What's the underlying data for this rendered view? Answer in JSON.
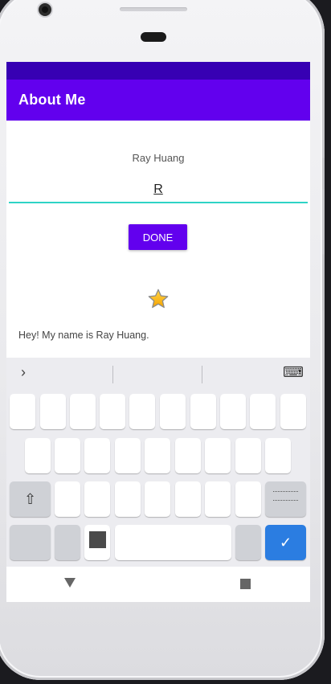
{
  "app": {
    "title": "About Me",
    "colors": {
      "status_bar": "#3700b3",
      "app_bar": "#6200ee",
      "input_underline": "#2ed3c6",
      "done_button": "#6200ee"
    }
  },
  "profile": {
    "name": "Ray Huang",
    "nickname_value": "R",
    "done_label": "DONE",
    "star_icon": "star-icon",
    "bio": "Hey! My name is Ray Huang."
  },
  "keyboard": {
    "expand_icon": "chevron-right-icon",
    "keyboard_settings_icon": "keyboard-icon",
    "shift_icon": "shift-icon",
    "enter_icon": "check-icon"
  },
  "navigation": {
    "back_icon": "back-triangle-icon",
    "recents_icon": "recents-square-icon"
  }
}
